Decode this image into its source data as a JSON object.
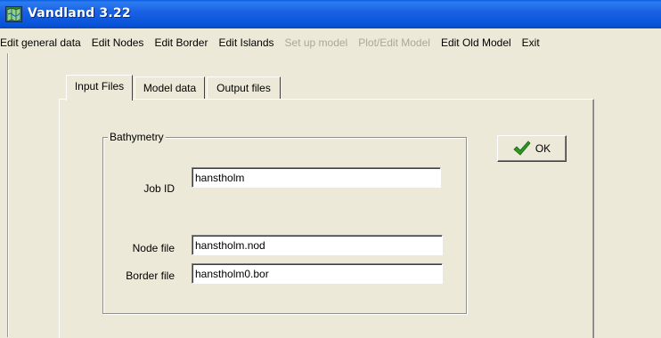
{
  "window": {
    "title": "Vandland 3.22",
    "icon": "map-icon"
  },
  "menu": {
    "items": [
      {
        "label": "Edit general data",
        "enabled": true
      },
      {
        "label": "Edit Nodes",
        "enabled": true
      },
      {
        "label": "Edit Border",
        "enabled": true
      },
      {
        "label": "Edit Islands",
        "enabled": true
      },
      {
        "label": "Set up model",
        "enabled": false
      },
      {
        "label": "Plot/Edit Model",
        "enabled": false
      },
      {
        "label": "Edit Old Model",
        "enabled": true
      },
      {
        "label": "Exit",
        "enabled": true
      }
    ]
  },
  "tabs": [
    {
      "label": "Input Files",
      "active": true
    },
    {
      "label": "Model data",
      "active": false
    },
    {
      "label": "Output files",
      "active": false
    }
  ],
  "bathymetry": {
    "group_label": "Bathymetry",
    "job_id_label": "Job ID",
    "job_id_value": "hanstholm",
    "node_file_label": "Node file",
    "node_file_value": "hanstholm.nod",
    "border_file_label": "Border file",
    "border_file_value": "hanstholm0.bor"
  },
  "ok_button": {
    "label": "OK",
    "icon": "checkmark-icon"
  },
  "colors": {
    "titlebar": "#0a5ee0",
    "face": "#ece9d8",
    "disabled_text": "#aca899",
    "check_green": "#2c9a1f"
  }
}
